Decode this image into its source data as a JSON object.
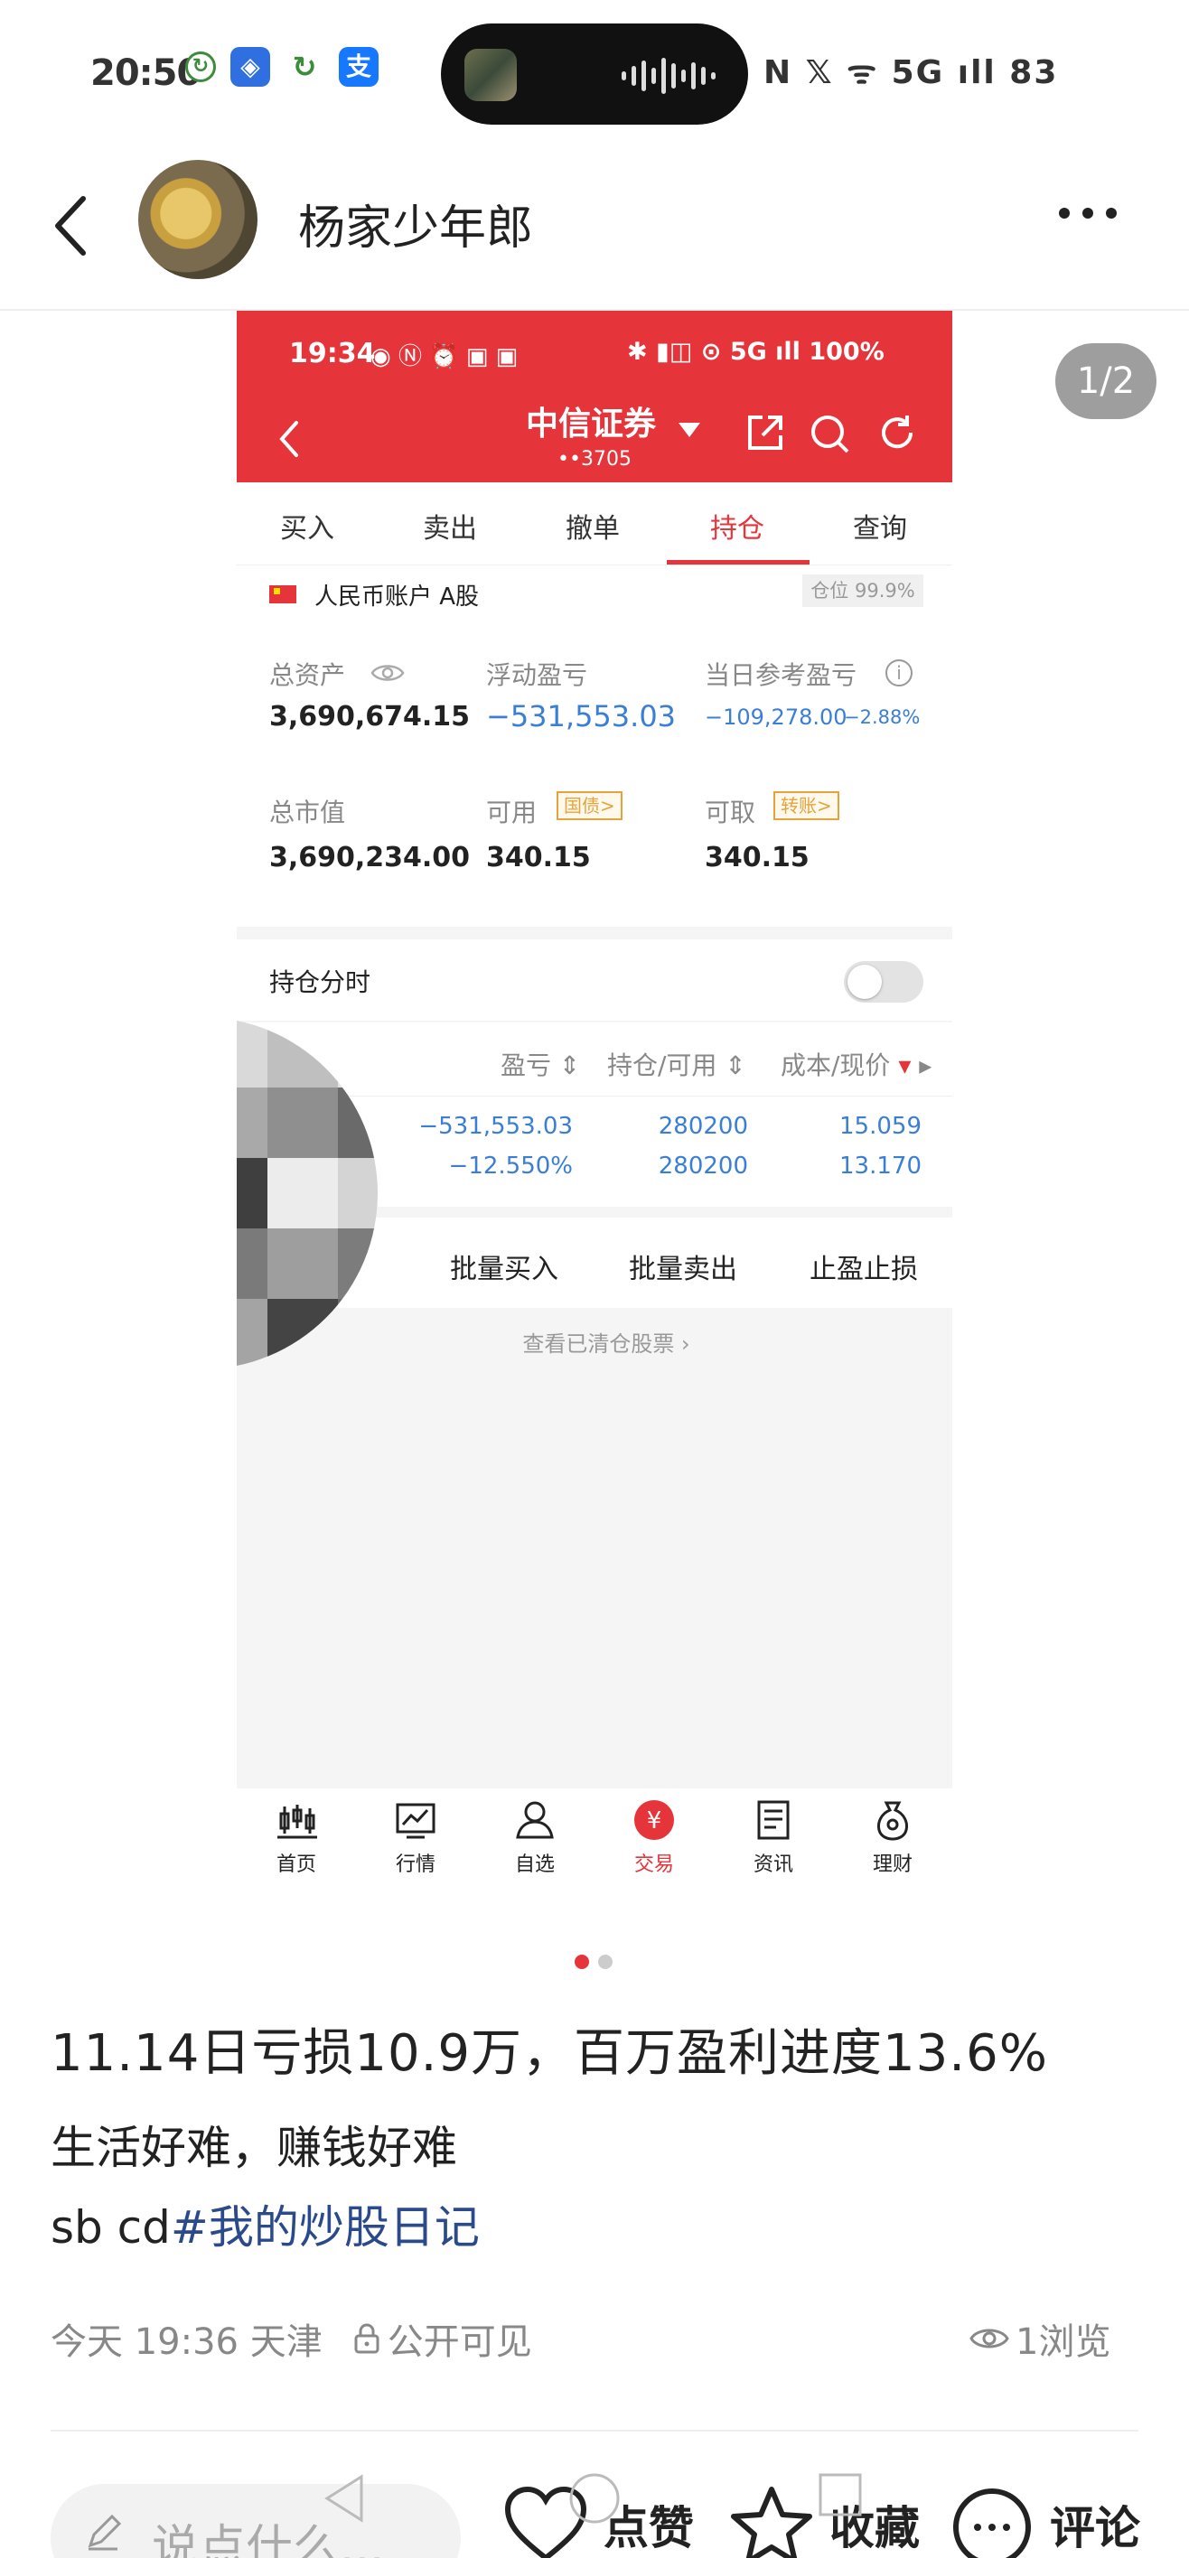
{
  "status_bar": {
    "time": "20:50",
    "right_text": "N 𝕏 ᯤ 5G ıll 83"
  },
  "header": {
    "author_name": "杨家少年郎"
  },
  "image_viewer": {
    "page_indicator": "1/2"
  },
  "broker_app": {
    "status_time": "19:34",
    "status_right": "5G ıll 100%",
    "title": "中信证券",
    "account_mask": "••3705",
    "tabs": [
      "买入",
      "卖出",
      "撤单",
      "持仓",
      "查询"
    ],
    "active_tab": "持仓",
    "account_label": "人民币账户 A股",
    "position_ratio": "仓位 99.9%",
    "total_assets_label": "总资产",
    "total_assets": "3,690,674.15",
    "floating_pnl_label": "浮动盈亏",
    "floating_pnl": "−531,553.03",
    "daily_pnl_label": "当日参考盈亏",
    "daily_pnl": "−109,278.00",
    "daily_pnl_pct": "−2.88%",
    "market_value_label": "总市值",
    "market_value": "3,690,234.00",
    "available_label": "可用",
    "available_tag": "国债>",
    "available": "340.15",
    "withdrawable_label": "可取",
    "withdrawable_tag": "转账>",
    "withdrawable": "340.15",
    "split_label": "持仓分时",
    "columns": [
      "盈亏",
      "持仓/可用",
      "成本/现价"
    ],
    "holding": {
      "pnl": "−531,553.03",
      "pnl_pct": "−12.550%",
      "position": "280200",
      "available": "280200",
      "cost": "15.059",
      "price": "13.170"
    },
    "actions": [
      "批量买入",
      "批量卖出",
      "止盈止损"
    ],
    "cleared_link": "查看已清仓股票",
    "nav": [
      "首页",
      "行情",
      "自选",
      "交易",
      "资讯",
      "理财"
    ],
    "nav_active": "交易",
    "colors": {
      "brand": "#e5343a",
      "loss_blue": "#3a7fd4"
    }
  },
  "post": {
    "title": "11.14日亏损10.9万，百万盈利进度13.6%",
    "body_line1": "生活好难，赚钱好难",
    "body_prefix": "sb  cd",
    "hashtag": "#我的炒股日记",
    "time_location": "今天 19:36 天津",
    "visibility": "公开可见",
    "views": "1浏览"
  },
  "bottom_bar": {
    "comment_placeholder": "说点什么...",
    "like": "点赞",
    "favorite": "收藏",
    "comment": "评论"
  }
}
